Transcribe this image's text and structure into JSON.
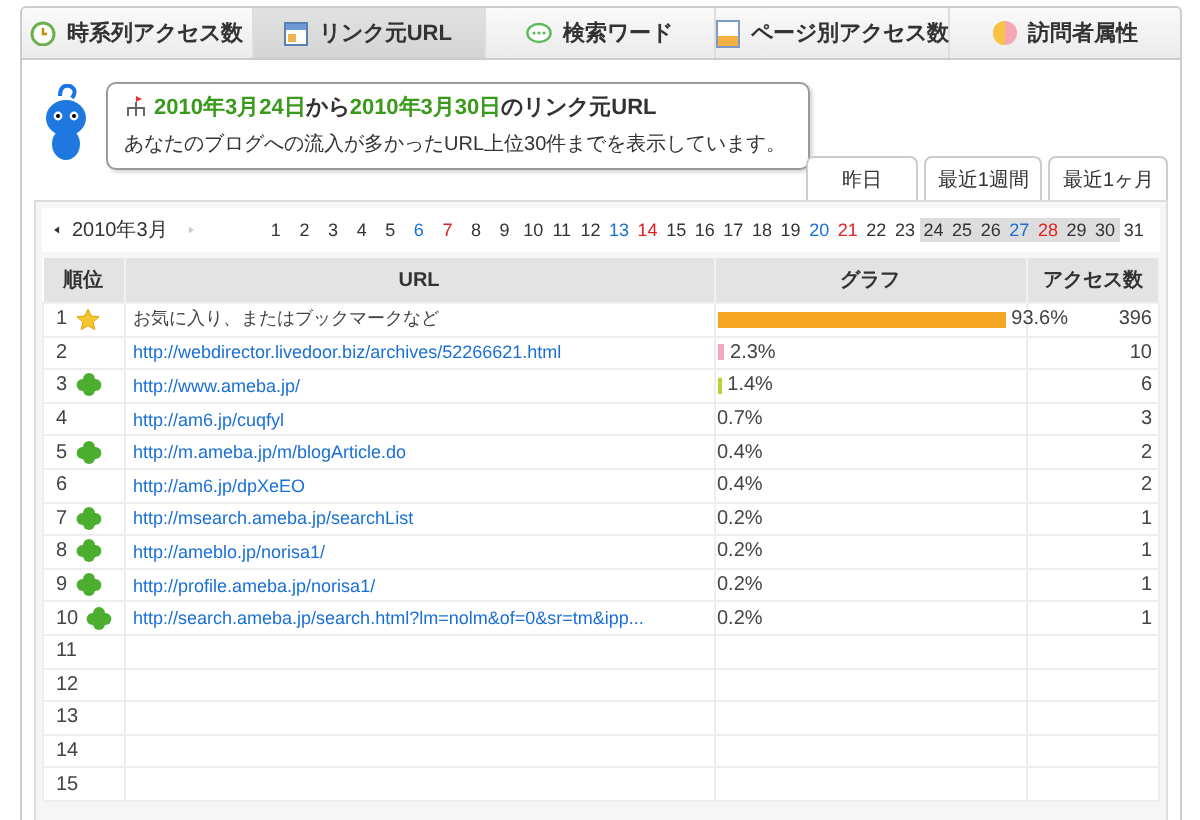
{
  "tabs": [
    {
      "label": "時系列アクセス数",
      "kind": "clock",
      "selected": false
    },
    {
      "label": "リンク元URL",
      "kind": "window",
      "selected": true
    },
    {
      "label": "検索ワード",
      "kind": "bubble",
      "selected": false
    },
    {
      "label": "ページ別アクセス数",
      "kind": "page",
      "selected": false
    },
    {
      "label": "訪問者属性",
      "kind": "pie",
      "selected": false
    }
  ],
  "notice": {
    "date_from": "2010年3月24日",
    "connector_1": "から",
    "date_to": "2010年3月30日",
    "connector_2": "のリンク元URL",
    "description": "あなたのブログへの流入が多かったURL上位30件までを表示しています。"
  },
  "period_tabs": [
    {
      "label": "昨日",
      "selected": false
    },
    {
      "label": "最近1週間",
      "selected": false
    },
    {
      "label": "最近1ヶ月",
      "selected": false
    }
  ],
  "calendar": {
    "month": "2010年3月",
    "next_disabled": true,
    "days": [
      {
        "label": "1",
        "kind": "weekday",
        "in_range": false
      },
      {
        "label": "2",
        "kind": "weekday",
        "in_range": false
      },
      {
        "label": "3",
        "kind": "weekday",
        "in_range": false
      },
      {
        "label": "4",
        "kind": "weekday",
        "in_range": false
      },
      {
        "label": "5",
        "kind": "weekday",
        "in_range": false
      },
      {
        "label": "6",
        "kind": "saturday",
        "in_range": false
      },
      {
        "label": "7",
        "kind": "sunday",
        "in_range": false
      },
      {
        "label": "8",
        "kind": "weekday",
        "in_range": false
      },
      {
        "label": "9",
        "kind": "weekday",
        "in_range": false
      },
      {
        "label": "10",
        "kind": "weekday",
        "in_range": false
      },
      {
        "label": "11",
        "kind": "weekday",
        "in_range": false
      },
      {
        "label": "12",
        "kind": "weekday",
        "in_range": false
      },
      {
        "label": "13",
        "kind": "saturday",
        "in_range": false
      },
      {
        "label": "14",
        "kind": "sunday",
        "in_range": false
      },
      {
        "label": "15",
        "kind": "weekday",
        "in_range": false
      },
      {
        "label": "16",
        "kind": "weekday",
        "in_range": false
      },
      {
        "label": "17",
        "kind": "weekday",
        "in_range": false
      },
      {
        "label": "18",
        "kind": "weekday",
        "in_range": false
      },
      {
        "label": "19",
        "kind": "weekday",
        "in_range": false
      },
      {
        "label": "20",
        "kind": "saturday",
        "in_range": false
      },
      {
        "label": "21",
        "kind": "sunday",
        "in_range": false
      },
      {
        "label": "22",
        "kind": "weekday",
        "in_range": false
      },
      {
        "label": "23",
        "kind": "weekday",
        "in_range": false
      },
      {
        "label": "24",
        "kind": "weekday",
        "in_range": true
      },
      {
        "label": "25",
        "kind": "weekday",
        "in_range": true
      },
      {
        "label": "26",
        "kind": "weekday",
        "in_range": true
      },
      {
        "label": "27",
        "kind": "saturday",
        "in_range": true
      },
      {
        "label": "28",
        "kind": "sunday",
        "in_range": true
      },
      {
        "label": "29",
        "kind": "weekday",
        "in_range": true
      },
      {
        "label": "30",
        "kind": "weekday",
        "in_range": true
      },
      {
        "label": "31",
        "kind": "weekday",
        "in_range": false
      }
    ]
  },
  "table": {
    "columns": [
      "順位",
      "URL",
      "グラフ",
      "アクセス数"
    ],
    "rows": [
      {
        "rank": "1",
        "kind": "star",
        "url": "お気に入り、またはブックマークなど",
        "is_link": false,
        "level": 0.936,
        "color": "#f5a623",
        "percent": "93.6%",
        "count": "396"
      },
      {
        "rank": "2",
        "kind": "plain",
        "url": "http://webdirector.livedoor.biz/archives/52266621.html",
        "is_link": true,
        "level": 0.023,
        "color": "#f4a7c0",
        "percent": "2.3%",
        "count": "10"
      },
      {
        "rank": "3",
        "kind": "clover",
        "url": "http://www.ameba.jp/",
        "is_link": true,
        "level": 0.014,
        "color": "#b5d334",
        "percent": "1.4%",
        "count": "6"
      },
      {
        "rank": "4",
        "kind": "plain",
        "url": "http://am6.jp/cuqfyl",
        "is_link": true,
        "percent": "0.7%",
        "count": "3"
      },
      {
        "rank": "5",
        "kind": "clover",
        "url": "http://m.ameba.jp/m/blogArticle.do",
        "is_link": true,
        "percent": "0.4%",
        "count": "2"
      },
      {
        "rank": "6",
        "kind": "plain",
        "url": "http://am6.jp/dpXeEO",
        "is_link": true,
        "percent": "0.4%",
        "count": "2"
      },
      {
        "rank": "7",
        "kind": "clover",
        "url": "http://msearch.ameba.jp/searchList",
        "is_link": true,
        "percent": "0.2%",
        "count": "1"
      },
      {
        "rank": "8",
        "kind": "clover",
        "url": "http://ameblo.jp/norisa1/",
        "is_link": true,
        "percent": "0.2%",
        "count": "1"
      },
      {
        "rank": "9",
        "kind": "clover",
        "url": "http://profile.ameba.jp/norisa1/",
        "is_link": true,
        "percent": "0.2%",
        "count": "1"
      },
      {
        "rank": "10",
        "kind": "clover",
        "url": "http://search.ameba.jp/search.html?lm=nolm&of=0&sr=tm&ipp...",
        "is_link": true,
        "percent": "0.2%",
        "count": "1"
      },
      {
        "rank": "11"
      },
      {
        "rank": "12"
      },
      {
        "rank": "13"
      },
      {
        "rank": "14"
      },
      {
        "rank": "15"
      }
    ]
  }
}
